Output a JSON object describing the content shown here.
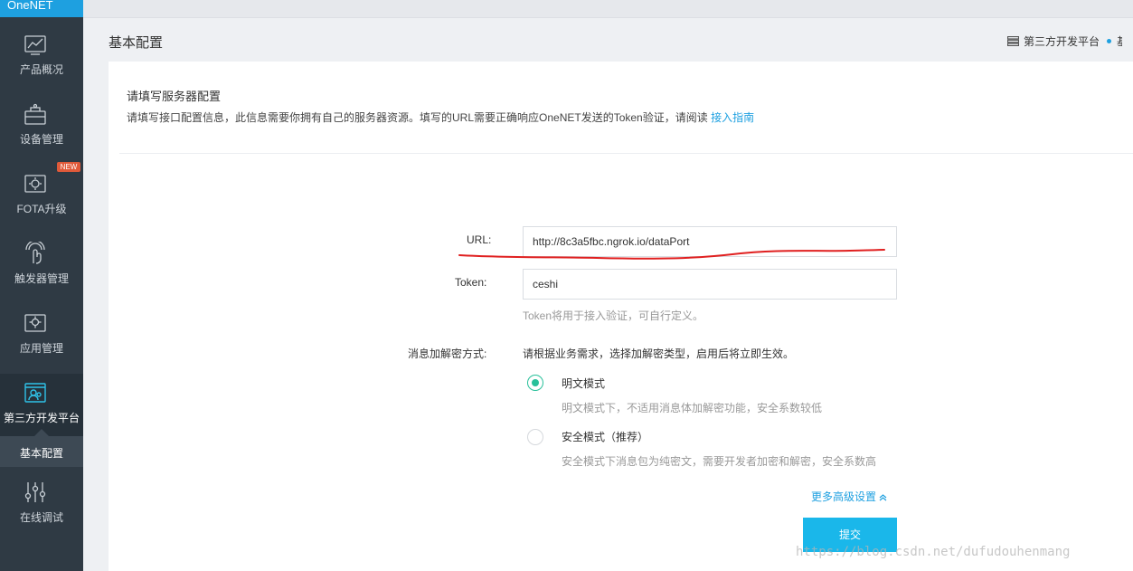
{
  "sidebar": {
    "brand": "OneNET",
    "items": [
      {
        "label": "产品概况",
        "icon": "chart-icon"
      },
      {
        "label": "设备管理",
        "icon": "device-icon"
      },
      {
        "label": "FOTA升级",
        "icon": "fota-icon",
        "badge": "NEW"
      },
      {
        "label": "触发器管理",
        "icon": "touch-icon"
      },
      {
        "label": "应用管理",
        "icon": "app-icon"
      },
      {
        "label": "第三方开发平台",
        "icon": "platform-icon"
      },
      {
        "label": "在线调试",
        "icon": "sliders-icon"
      }
    ],
    "sub_item": "基本配置"
  },
  "header": {
    "title": "基本配置",
    "right_link": "第三方开发平台"
  },
  "intro": {
    "title": "请填写服务器配置",
    "desc": "请填写接口配置信息，此信息需要你拥有自己的服务器资源。填写的URL需要正确响应OneNET发送的Token验证，请阅读",
    "link": "接入指南"
  },
  "form": {
    "url_label": "URL:",
    "url_value": "http://8c3a5fbc.ngrok.io/dataPort",
    "token_label": "Token:",
    "token_value": "ceshi",
    "token_hint": "Token将用于接入验证，可自行定义。",
    "encrypt_label": "消息加解密方式:",
    "encrypt_desc": "请根据业务需求，选择加解密类型，启用后将立即生效。",
    "modes": [
      {
        "title": "明文模式",
        "desc": "明文模式下，不适用消息体加解密功能，安全系数较低",
        "checked": true
      },
      {
        "title": "安全模式（推荐）",
        "desc": "安全模式下消息包为纯密文，需要开发者加密和解密，安全系数高",
        "checked": false
      }
    ],
    "advanced": "更多高级设置",
    "submit": "提交"
  },
  "watermark": "https://blog.csdn.net/dufudouhenmang",
  "colors": {
    "accent": "#1ea0e0",
    "sidebar": "#2f3a44",
    "radio_checked": "#28c09a",
    "submit": "#1ab7ea",
    "annotation": "#e02020"
  }
}
